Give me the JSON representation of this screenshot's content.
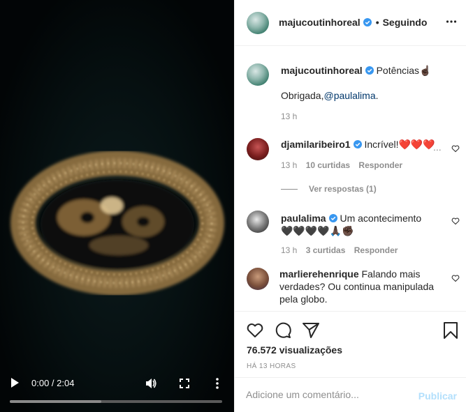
{
  "video": {
    "time": "0:00 / 2:04",
    "progress_played": 0.0,
    "progress_buffered": 0.43,
    "icons": [
      "play-icon",
      "volume-icon",
      "fullscreen-icon",
      "more-vertical-icon"
    ]
  },
  "header": {
    "username": "majucoutinhoreal",
    "separator": "•",
    "follow_label": "Seguindo",
    "verified_color": "#3897f0"
  },
  "caption": {
    "username": "majucoutinhoreal",
    "text": "Potências☝🏿",
    "line2_prefix": "Obrigada,",
    "mention": "@paulalima",
    "line2_suffix": ".",
    "time": "13 h"
  },
  "comments": [
    {
      "username": "djamilaribeiro1",
      "verified": true,
      "text": "Incrível!❤️❤️❤️",
      "more": "...",
      "time": "13 h",
      "likes": "10 curtidas",
      "reply": "Responder",
      "view_replies": "Ver respostas (1)"
    },
    {
      "username": "paulalima",
      "verified": true,
      "text": "Um acontecimento",
      "text2": "🖤🖤🖤🖤🙏🏿✊🏿",
      "time": "13 h",
      "likes": "3 curtidas",
      "reply": "Responder"
    },
    {
      "username": "marlierehenrique",
      "verified": false,
      "text_line1": "Falando mais",
      "text_line2": "verdades? Ou continua manipulada",
      "text_line3": "pela globo."
    }
  ],
  "actions": {
    "views": "76.572 visualizações",
    "ago": "HÁ 13 HORAS",
    "icons": [
      "heart-icon",
      "comment-icon",
      "share-icon",
      "bookmark-icon"
    ]
  },
  "compose": {
    "placeholder": "Adicione um comentário...",
    "publish_label": "Publicar",
    "publish_color": "#b2dffc"
  }
}
